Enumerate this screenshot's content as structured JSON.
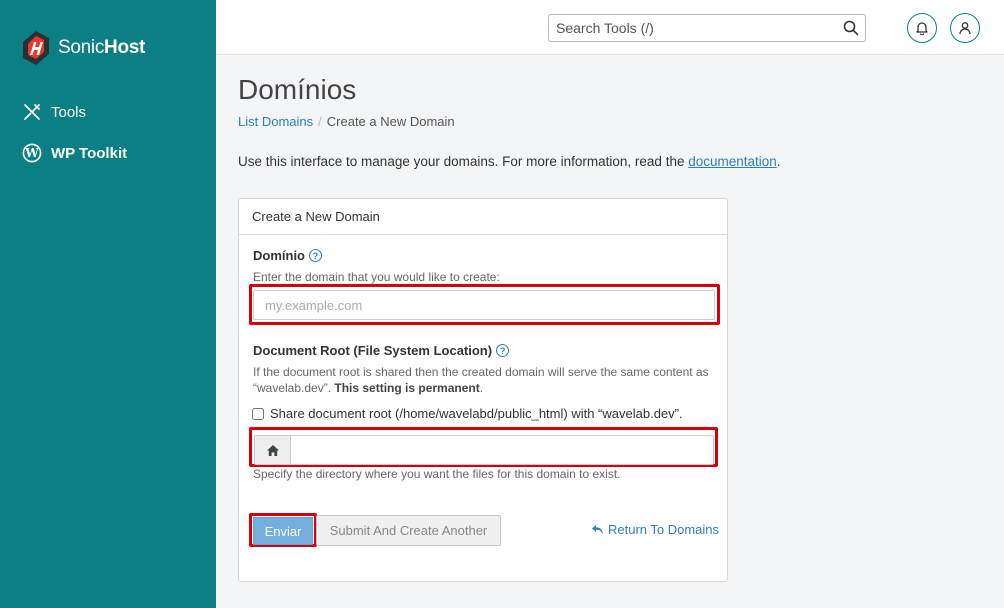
{
  "brand": {
    "name_light": "Sonic",
    "name_bold": "Host"
  },
  "sidebar": {
    "items": [
      {
        "label": "Tools",
        "icon": "tools-icon"
      },
      {
        "label": "WP Toolkit",
        "icon": "wordpress-icon"
      }
    ]
  },
  "topbar": {
    "search_placeholder": "Search Tools (/)",
    "icons": [
      "search-icon",
      "bell-icon",
      "user-icon"
    ]
  },
  "page": {
    "title": "Domínios",
    "breadcrumb": {
      "link": "List Domains",
      "separator": "/",
      "current": "Create a New Domain"
    },
    "intro_text": "Use this interface to manage your domains. For more information, read the ",
    "intro_link": "documentation",
    "intro_end": "."
  },
  "form": {
    "panel_title": "Create a New Domain",
    "domain_label": "Domínio",
    "domain_hint": "Enter the domain that you would like to create:",
    "domain_placeholder": "my.example.com",
    "domain_value": "",
    "docroot_label": "Document Root (File System Location)",
    "docroot_hint_1": "If the document root is shared then the created domain will serve the same content as “wavelab.dev”. ",
    "docroot_hint_bold": "This setting is permanent",
    "docroot_hint_end": ".",
    "share_checkbox_label": "Share document root (/home/wavelabd/public_html) with “wavelab.dev”.",
    "share_checked": false,
    "docroot_value": "",
    "docroot_after_hint": "Specify the directory where you want the files for this domain to exist.",
    "submit_label": "Enviar",
    "submit_another_label": "Submit And Create Another",
    "return_label": "Return To Domains",
    "help_glyph": "?"
  },
  "colors": {
    "sidebar_bg": "#0b7f83",
    "link": "#2d7fb8",
    "highlight": "#d4000d",
    "primary_button": "#74aedc"
  }
}
